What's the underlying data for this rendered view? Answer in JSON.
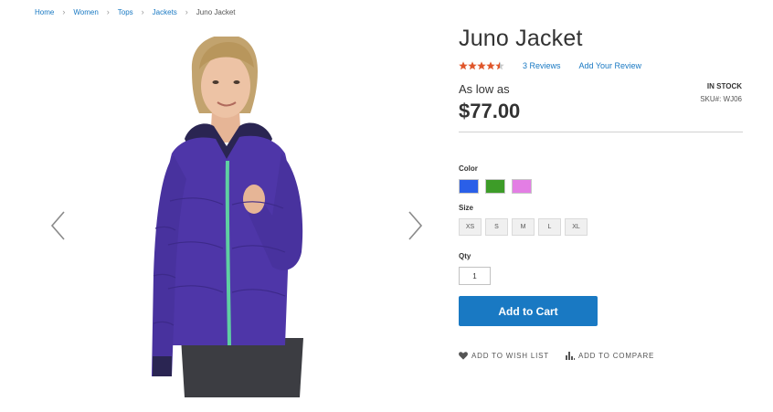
{
  "breadcrumb": {
    "items": [
      "Home",
      "Women",
      "Tops",
      "Jackets"
    ],
    "current": "Juno Jacket",
    "separator": "›"
  },
  "gallery": {
    "image_alt": "woman wearing purple quilted jacket",
    "prev_icon": "chevron-left-icon",
    "next_icon": "chevron-right-icon"
  },
  "product": {
    "title": "Juno Jacket",
    "rating": 4.5,
    "rating_max": 5,
    "reviews_label": "3  Reviews",
    "add_review_label": "Add Your Review",
    "price_label": "As low as",
    "price": "$77.00",
    "stock": "IN STOCK",
    "sku": "SKU#:  WJ06"
  },
  "options": {
    "color_label": "Color",
    "colors": [
      "#2a5fe8",
      "#3d9c28",
      "#e37ee4"
    ],
    "size_label": "Size",
    "sizes": [
      "XS",
      "S",
      "M",
      "L",
      "XL"
    ],
    "qty_label": "Qty",
    "qty_value": "1"
  },
  "actions": {
    "add_to_cart": "Add to Cart",
    "wish_list": "ADD TO WISH LIST",
    "compare": "ADD TO COMPARE"
  },
  "colors": {
    "accent": "#1979c3",
    "star": "#e0562a",
    "jacket": "#4e36a8"
  }
}
